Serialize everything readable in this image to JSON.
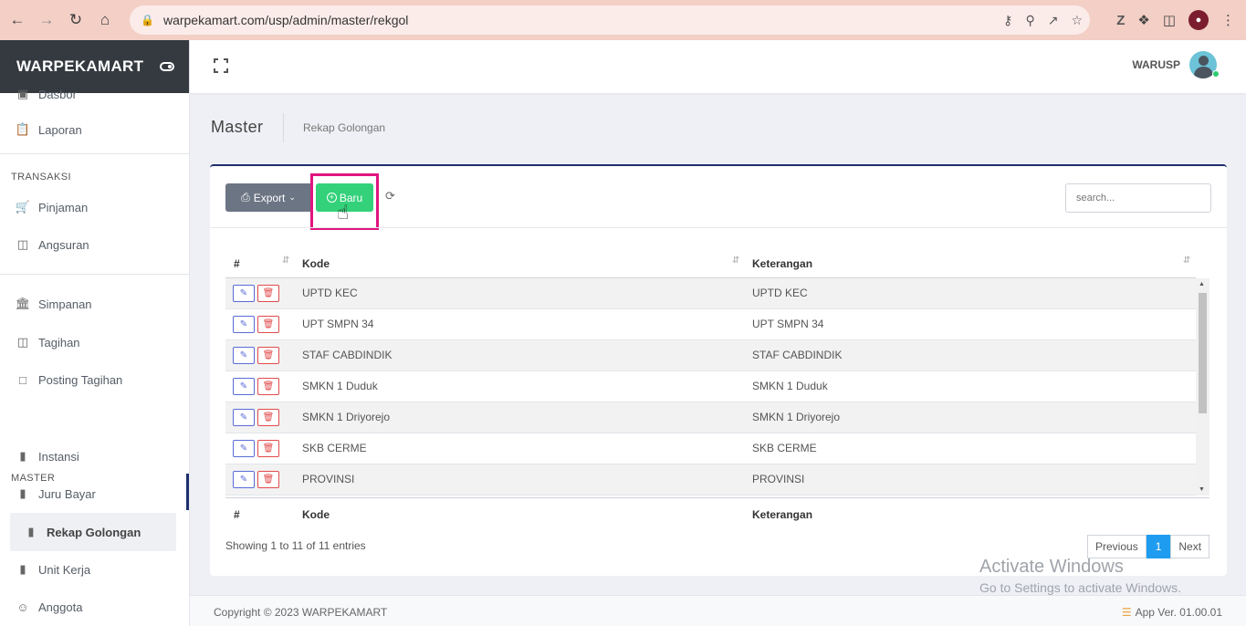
{
  "browser": {
    "url": "warpekamart.com/usp/admin/master/rekgol"
  },
  "brand": {
    "name": "WARPEKAMART"
  },
  "sidebar": {
    "items": [
      {
        "label": "Dasbor",
        "icon": "dashboard-icon"
      },
      {
        "label": "Laporan",
        "icon": "report-icon"
      },
      {
        "label": "Pinjaman",
        "icon": "cart-icon"
      },
      {
        "label": "Angsuran",
        "icon": "money-icon"
      },
      {
        "label": "Simpanan",
        "icon": "bank-icon"
      },
      {
        "label": "Tagihan",
        "icon": "money-icon"
      },
      {
        "label": "Posting Tagihan",
        "icon": "note-icon"
      },
      {
        "label": "Instansi",
        "icon": "book-icon"
      },
      {
        "label": "Juru Bayar",
        "icon": "book-icon"
      },
      {
        "label": "Rekap Golongan",
        "icon": "book-icon"
      },
      {
        "label": "Unit Kerja",
        "icon": "book-icon"
      },
      {
        "label": "Anggota",
        "icon": "user-icon"
      }
    ],
    "headings": {
      "transaksi": "TRANSAKSI",
      "master": "MASTER"
    }
  },
  "header": {
    "username": "WARUSP"
  },
  "page": {
    "title": "Master",
    "breadcrumb": "Rekap Golongan"
  },
  "toolbar": {
    "export_label": "Export",
    "new_label": "Baru",
    "search_placeholder": "search..."
  },
  "table": {
    "columns": [
      "#",
      "Kode",
      "Keterangan"
    ],
    "rows": [
      {
        "kode": "UPTD KEC",
        "keterangan": "UPTD KEC"
      },
      {
        "kode": "UPT SMPN 34",
        "keterangan": "UPT SMPN 34"
      },
      {
        "kode": "STAF CABDINDIK",
        "keterangan": "STAF CABDINDIK"
      },
      {
        "kode": "SMKN 1 Duduk",
        "keterangan": "SMKN 1 Duduk"
      },
      {
        "kode": "SMKN 1 Driyorejo",
        "keterangan": "SMKN 1 Driyorejo"
      },
      {
        "kode": "SKB CERME",
        "keterangan": "SKB CERME"
      },
      {
        "kode": "PROVINSI",
        "keterangan": "PROVINSI"
      }
    ],
    "info": "Showing 1 to 11 of 11 entries",
    "pagination": {
      "previous": "Previous",
      "current": "1",
      "next": "Next"
    }
  },
  "footer": {
    "copyright": "Copyright © 2023 WARPEKAMART",
    "version": "App Ver. 01.00.01"
  },
  "watermark": {
    "line1": "Activate Windows",
    "line2": "Go to Settings to activate Windows."
  },
  "colors": {
    "brand_dark": "#343a40",
    "accent_blue": "#1e2e6e",
    "new_button": "#33d17a",
    "highlight": "#e0157f",
    "page_active": "#1e9cf0"
  }
}
